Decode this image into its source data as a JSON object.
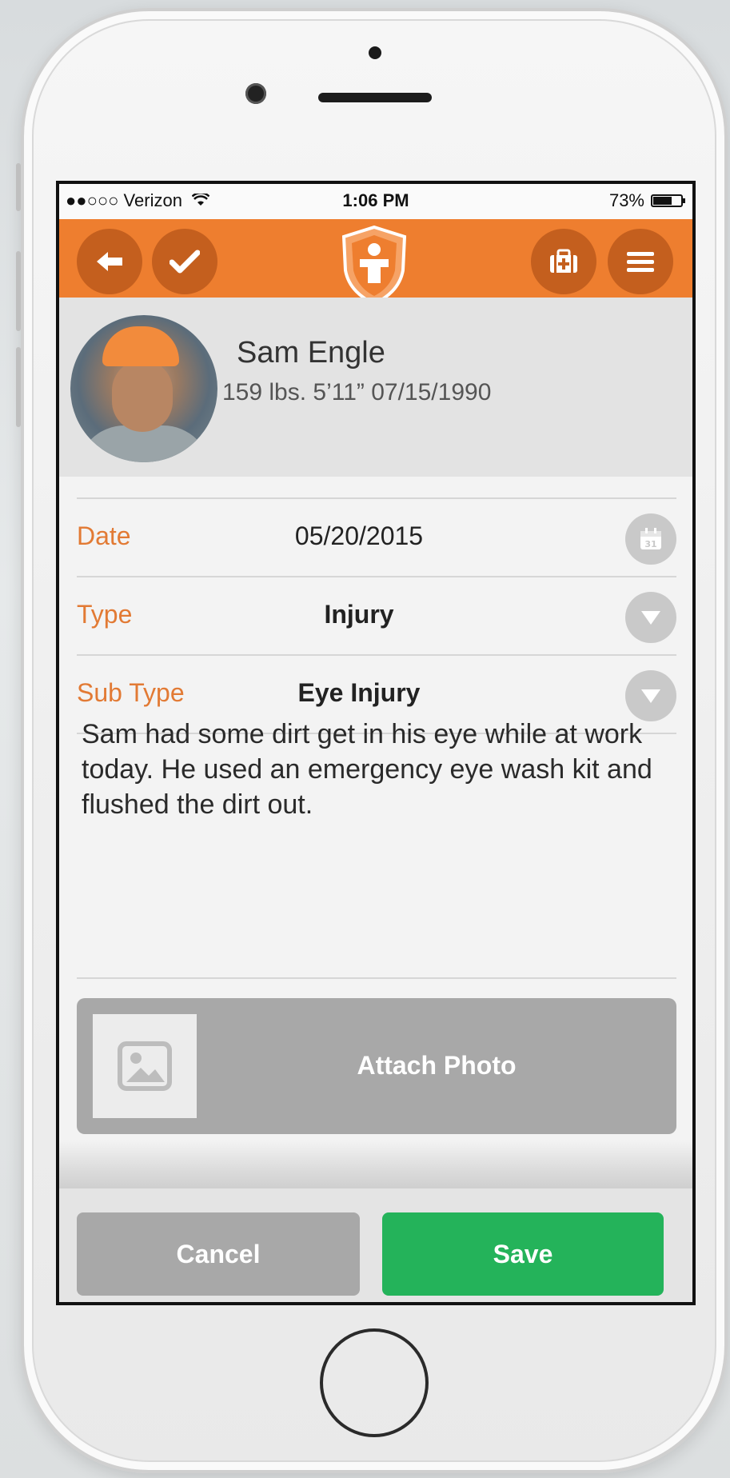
{
  "status_bar": {
    "carrier": "●●○○○ Verizon",
    "time": "1:06 PM",
    "battery_percent_label": "73%",
    "battery_level": 0.73
  },
  "nav": {
    "back_icon": "back-arrow-icon",
    "check_icon": "checkmark-icon",
    "logo_icon": "shield-logo-icon",
    "firstaid_icon": "first-aid-kit-icon",
    "menu_icon": "hamburger-menu-icon",
    "accent_color": "#ee7e2f"
  },
  "profile": {
    "name": "Sam Engle",
    "stats": "159 lbs. 5’11” 07/15/1990"
  },
  "form": {
    "date_label": "Date",
    "date_value": "05/20/2015",
    "date_icon_text": "31",
    "type_label": "Type",
    "type_value": "Injury",
    "subtype_label": "Sub Type",
    "subtype_value": "Eye Injury"
  },
  "notes": "Sam had some dirt get in his eye while at work today. He used an emergency eye wash kit and flushed the dirt out.",
  "attach": {
    "label": "Attach Photo",
    "icon": "image-icon"
  },
  "footer": {
    "cancel_label": "Cancel",
    "save_label": "Save",
    "save_color": "#24b35a"
  }
}
